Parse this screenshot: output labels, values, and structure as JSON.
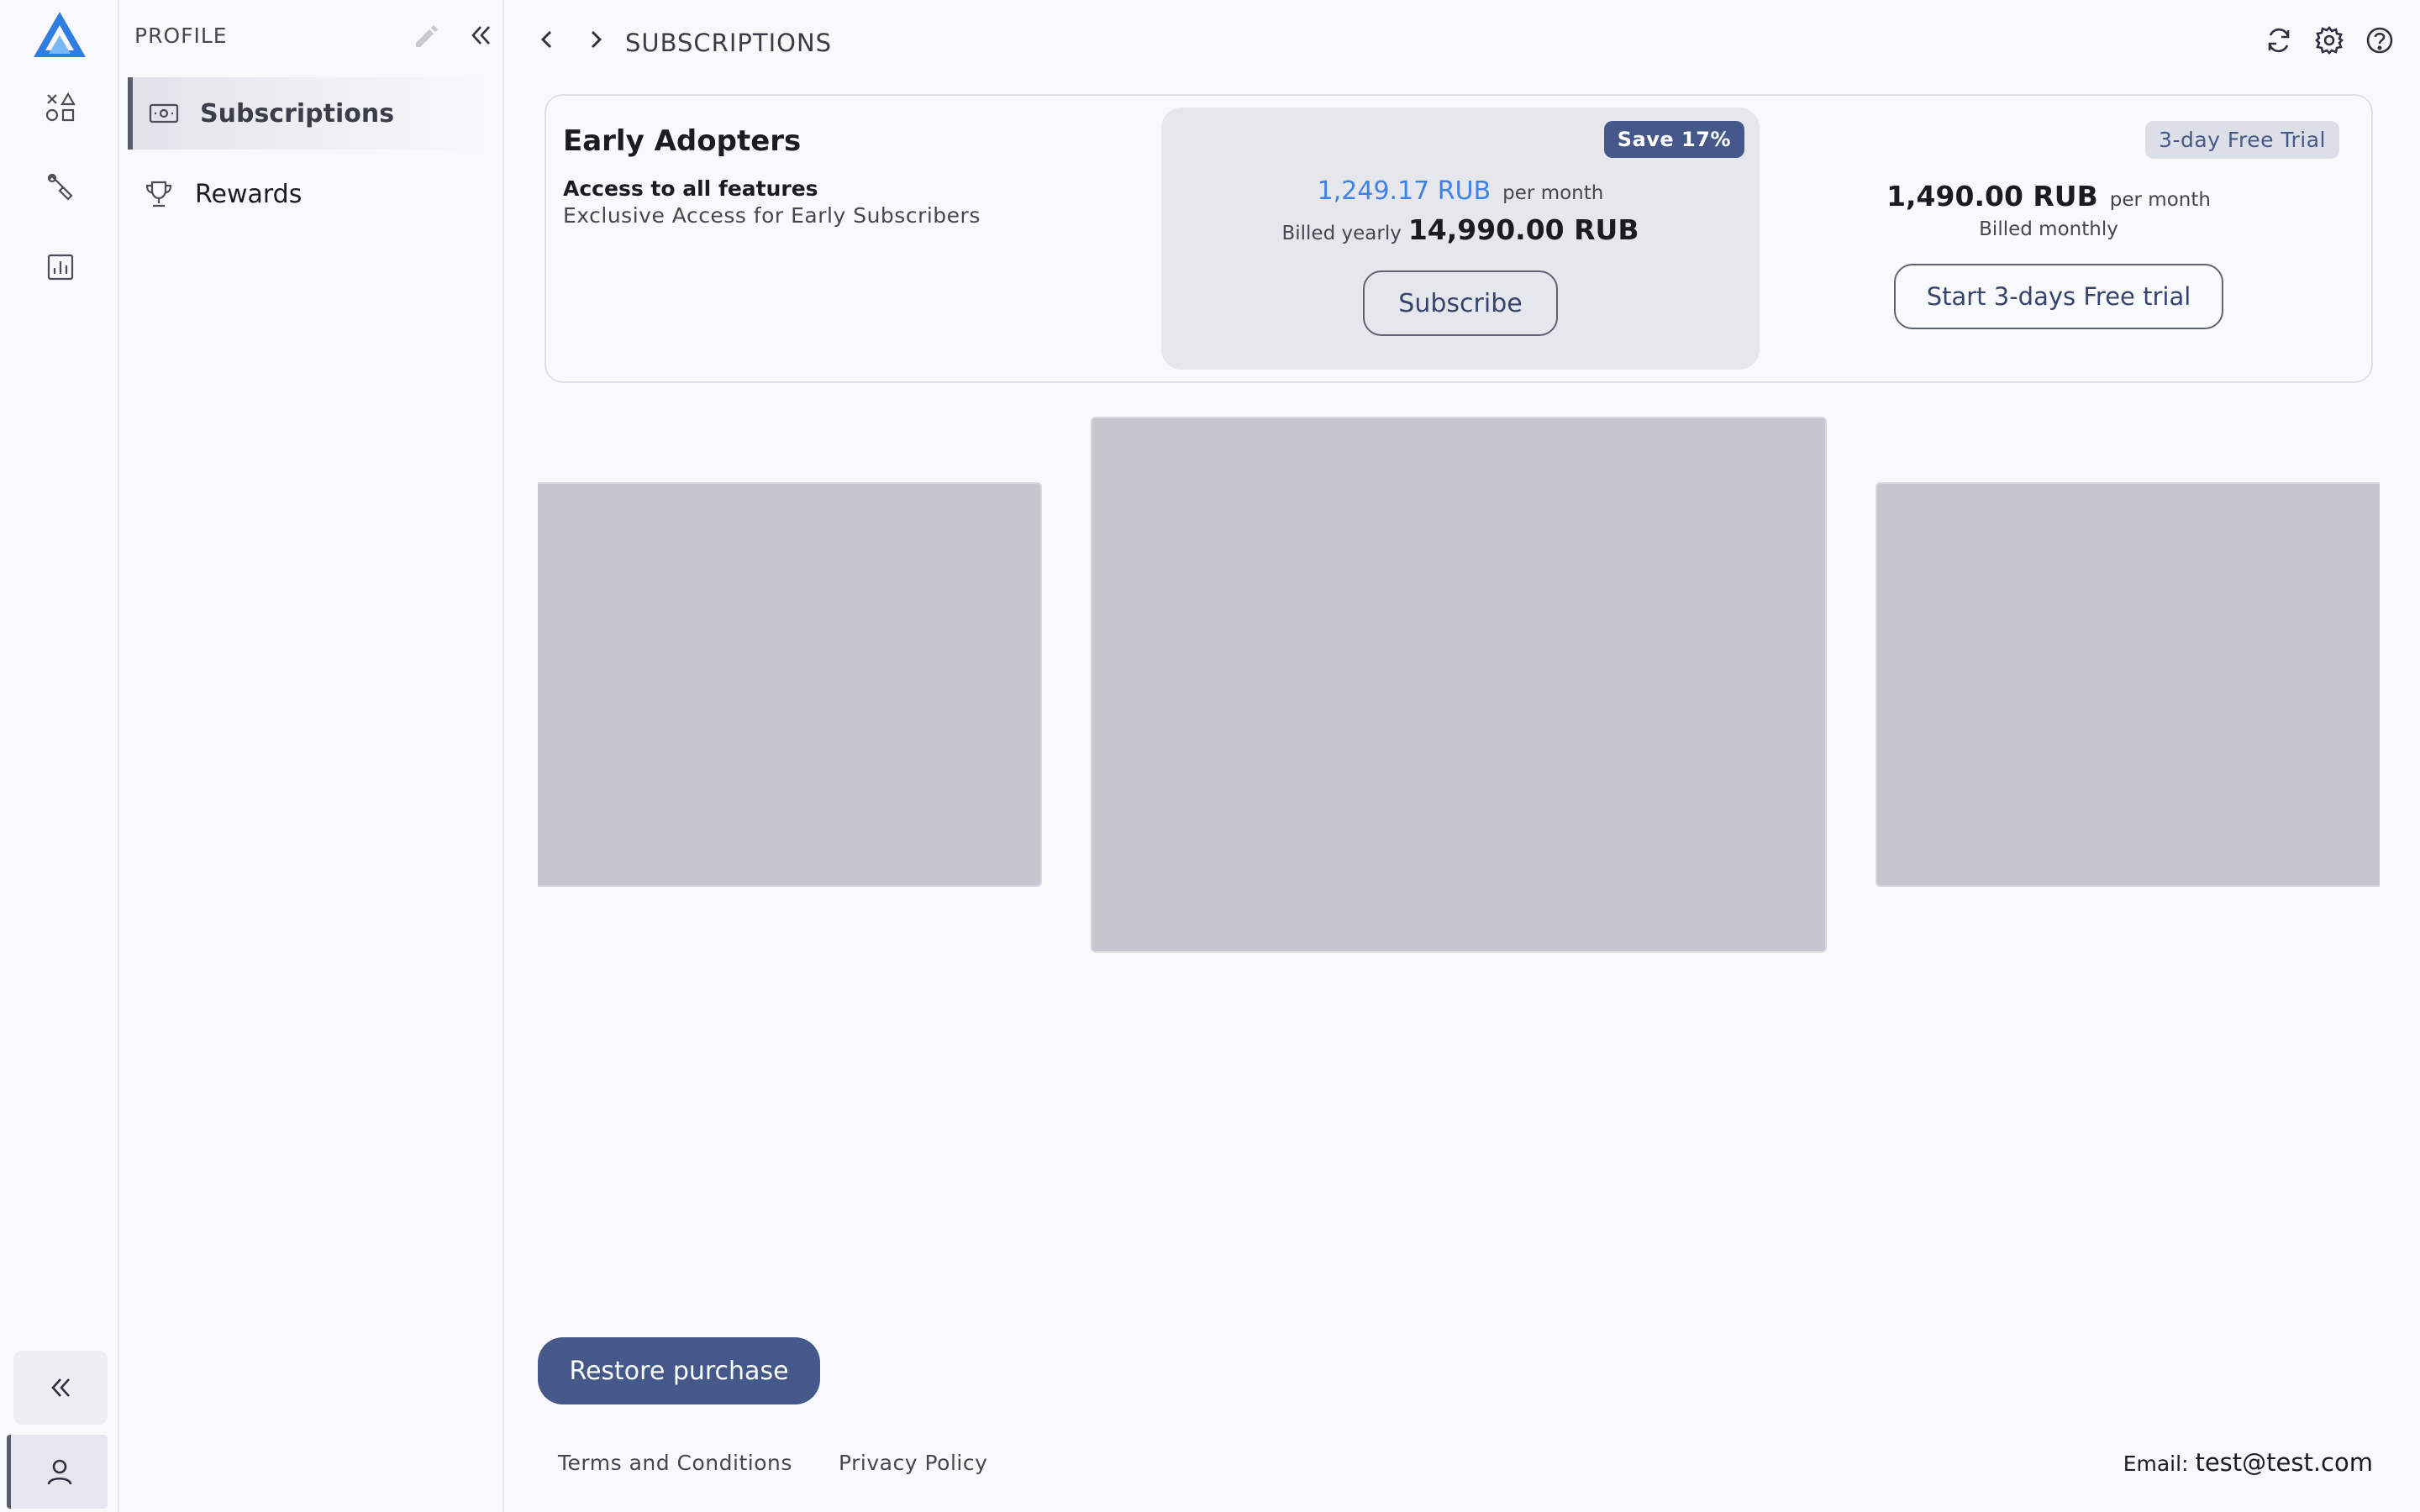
{
  "sidebar": {
    "panel_title": "PROFILE",
    "items": [
      {
        "label": "Subscriptions",
        "icon": "banknote-icon",
        "active": true
      },
      {
        "label": "Rewards",
        "icon": "trophy-icon",
        "active": false
      }
    ]
  },
  "header": {
    "title": "SUBSCRIPTIONS"
  },
  "plan": {
    "name": "Early Adopters",
    "feature": "Access to all features",
    "description": "Exclusive Access for Early Subscribers",
    "yearly": {
      "badge": "Save 17%",
      "price_per_month": "1,249.17 RUB",
      "per_month_label": "per month",
      "billed_label": "Billed yearly",
      "billed_amount": "14,990.00 RUB",
      "button": "Subscribe"
    },
    "monthly": {
      "badge": "3-day Free Trial",
      "price": "1,490.00 RUB",
      "per_month_label": "per month",
      "billed_label": "Billed monthly",
      "button": "Start 3-days Free trial"
    }
  },
  "footer": {
    "restore_button": "Restore purchase",
    "terms": "Terms and Conditions",
    "privacy": "Privacy Policy",
    "email_label": "Email:",
    "email_value": "test@test.com"
  },
  "colors": {
    "primary": "#44598a",
    "accent_price": "#3f82e6",
    "logo": "#2f7de1",
    "placeholder": "#c4c7cf"
  }
}
